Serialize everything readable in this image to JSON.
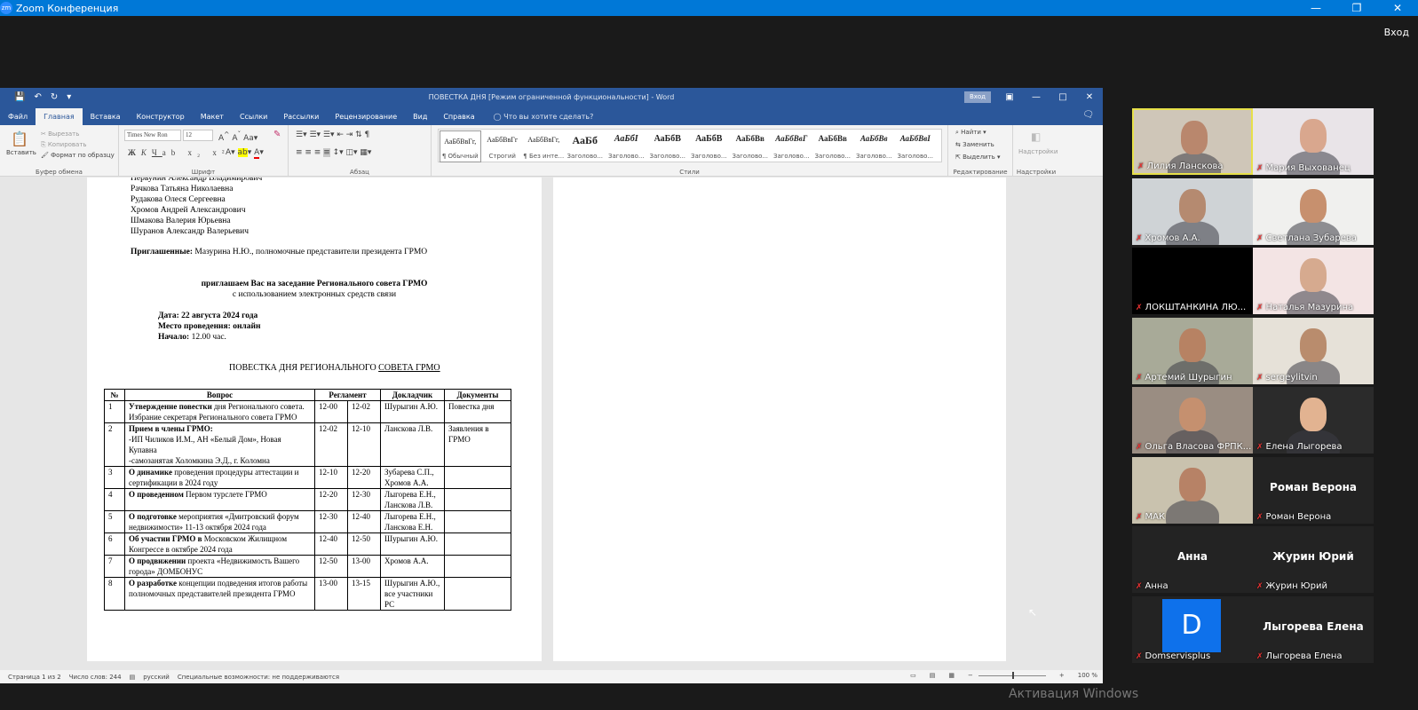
{
  "zoom": {
    "title": "Zoom Конференция",
    "logo": "zm",
    "enter_label": "Вход",
    "watermark": "Активация Windows"
  },
  "word": {
    "doc_title": "ПОВЕСТКА ДНЯ [Режим ограниченной функциональности]  -  Word",
    "signin": "Вход",
    "tabs": [
      "Файл",
      "Главная",
      "Вставка",
      "Конструктор",
      "Макет",
      "Ссылки",
      "Рассылки",
      "Рецензирование",
      "Вид",
      "Справка"
    ],
    "active_tab": "Главная",
    "tell_me": "Что вы хотите сделать?",
    "clipboard": {
      "paste": "Вставить",
      "cut": "Вырезать",
      "copy": "Копировать",
      "format": "Формат по образцу",
      "label": "Буфер обмена"
    },
    "font": {
      "name": "Times New Ron",
      "size": "12",
      "label": "Шрифт"
    },
    "paragraph_label": "Абзац",
    "styles": [
      {
        "preview": "АаБбВвГг,",
        "name": "¶ Обычный"
      },
      {
        "preview": "АаБбВвГг",
        "name": "Строгий"
      },
      {
        "preview": "АаБбВвГг,",
        "name": "¶ Без инте..."
      },
      {
        "preview": "АаБб",
        "name": "Заголово..."
      },
      {
        "preview": "АаБбІ",
        "name": "Заголово..."
      },
      {
        "preview": "АаБбВ",
        "name": "Заголово..."
      },
      {
        "preview": "АаБбВ",
        "name": "Заголово..."
      },
      {
        "preview": "АаБбВв",
        "name": "Заголово..."
      },
      {
        "preview": "АаБбВвГ",
        "name": "Заголово..."
      },
      {
        "preview": "АаБбВв",
        "name": "Заголово..."
      },
      {
        "preview": "АаБбВв",
        "name": "Заголово..."
      },
      {
        "preview": "АаБбВвІ",
        "name": "Заголово..."
      }
    ],
    "styles_label": "Стили",
    "editing": {
      "find": "Найти",
      "replace": "Заменить",
      "select": "Выделить",
      "label": "Редактирование"
    },
    "addins": {
      "button": "Надстройки",
      "label": "Надстройки"
    },
    "status": {
      "page": "Страница 1 из 2",
      "words": "Число слов: 244",
      "lang": "русский",
      "access": "Специальные возможности: не поддерживаются",
      "zoom": "100 %"
    }
  },
  "document": {
    "members": [
      "Первунин Александр Владимирович",
      "Рачкова Татьяна Николаевна",
      "Рудакова Олеся Сергеевна",
      "Хромов Андрей Александрович",
      "Шмакова Валерия Юрьевна",
      "Шуранов Александр Валерьевич"
    ],
    "invited_label": "Приглашенные:",
    "invited_text": " Мазурина Н.Ю., полномочные представители президента ГРМО",
    "invite_line": "приглашаем Вас на заседание Регионального совета ГРМО",
    "invite_sub": "с использованием электронных средств связи",
    "date_label": "Дата:",
    "date_value": " 22 августа 2024 года",
    "place_label": "Место проведения:",
    "place_value": " онлайн",
    "start_label": "Начало:",
    "start_value": " 12.00 час.",
    "agenda_title": "ПОВЕСТКА ДНЯ РЕГИОНАЛЬНОГО",
    "agenda_title_u": "СОВЕТА  ГРМО",
    "headers": [
      "№",
      "Вопрос",
      "Регламент",
      "Докладчик",
      "Документы"
    ],
    "rows": [
      {
        "n": "1",
        "qb": "Утверждение повестки",
        "q": " дня Регионального совета.\nИзбрание секретаря Регионального совета ГРМО",
        "t1": "12-00",
        "t2": "12-02",
        "sp": "Шурыгин А.Ю.",
        "doc": "Повестка дня"
      },
      {
        "n": "2",
        "qb": "Прием в члены ГРМО:",
        "q": "\n-ИП Чиликов И.М., АН «Белый Дом», Новая Купавна\n-самозанятая Холомкина Э.Д., г. Коломна",
        "t1": "12-02",
        "t2": "12-10",
        "sp": "Ланскова Л.В.",
        "doc": "Заявления в ГРМО"
      },
      {
        "n": "3",
        "qb": "О динамике",
        "q": " проведения процедуры аттестации и сертификации в 2024 году",
        "t1": "12-10",
        "t2": "12-20",
        "sp": "Зубарева С.П., Хромов А.А.",
        "doc": ""
      },
      {
        "n": "4",
        "qb": "О проведенном",
        "q": " Первом турслете ГРМО",
        "t1": "12-20",
        "t2": "12-30",
        "sp": "Лыгорева Е.Н., Ланскова Л.В.",
        "doc": ""
      },
      {
        "n": "5",
        "qb": "О подготовке",
        "q": " мероприятия «Дмитровский форум недвижимости» 11-13 октября 2024 года",
        "t1": "12-30",
        "t2": "12-40",
        "sp": "Лыгорева Е.Н., Ланскова Е.Н.",
        "doc": ""
      },
      {
        "n": "6",
        "qb": "Об участии ГРМО в",
        "q": " Московском Жилищном Конгрессе в октябре 2024 года",
        "t1": "12-40",
        "t2": "12-50",
        "sp": "Шурыгин А.Ю.",
        "doc": ""
      },
      {
        "n": "7",
        "qb": "О продвижении",
        "q": " проекта «Недвижимость Вашего города» ДОМБОНУС",
        "t1": "12-50",
        "t2": "13-00",
        "sp": "Хромов А.А.",
        "doc": ""
      },
      {
        "n": "8",
        "qb": "О разработке",
        "q": " концепции подведения итогов работы полномочных представителей президента ГРМО",
        "t1": "13-00",
        "t2": "13-15",
        "sp": "Шурыгин А.Ю., все участники РС",
        "doc": ""
      }
    ]
  },
  "participants": [
    {
      "name": "Лилия Ланскова",
      "center": "",
      "active": true,
      "bg": "#cfc6b8",
      "face": "#b9876d"
    },
    {
      "name": "Мария Выхованец",
      "center": "",
      "bg": "#e9e4e8",
      "face": "#d9a78e"
    },
    {
      "name": "Хромов А.А.",
      "center": "",
      "bg": "#cfd3d6",
      "face": "#b58a70"
    },
    {
      "name": "Светлана Зубарева",
      "center": "",
      "bg": "#f0f0ee",
      "face": "#c7906e"
    },
    {
      "name": "ЛОКШТАНКИНА ЛЮ...",
      "center": "",
      "bg": "#000000",
      "face": ""
    },
    {
      "name": "Наталья Мазурина",
      "center": "",
      "bg": "#f3e4e4",
      "face": "#d6aa8f"
    },
    {
      "name": "Артемий Шурыгин",
      "center": "",
      "bg": "#a8aa98",
      "face": "#b78263"
    },
    {
      "name": "sergeylitvin",
      "center": "",
      "bg": "#e6e1d8",
      "face": "#b98c6d"
    },
    {
      "name": "Ольга Власова ФРПК...",
      "center": "",
      "bg": "#9a8d82",
      "face": "#c5906f"
    },
    {
      "name": "Елена Лыгорева",
      "center": "",
      "bg": "#2b2b2b",
      "face": "#e2b391"
    },
    {
      "name": "МАК",
      "center": "",
      "bg": "#c9c2ae",
      "face": "#b78266"
    },
    {
      "name": "Роман Верона",
      "center": "Роман Верона",
      "bg": "#232323",
      "face": ""
    },
    {
      "name": "Анна",
      "center": "Анна",
      "bg": "#232323",
      "face": ""
    },
    {
      "name": "Журин  Юрий",
      "center": "Журин  Юрий",
      "bg": "#232323",
      "face": ""
    },
    {
      "name": "Domservisplus",
      "center": "",
      "letter": "D",
      "bg": "#232323",
      "face": ""
    },
    {
      "name": "Лыгорева Елена",
      "center": "Лыгорева Елена",
      "bg": "#232323",
      "face": ""
    }
  ]
}
